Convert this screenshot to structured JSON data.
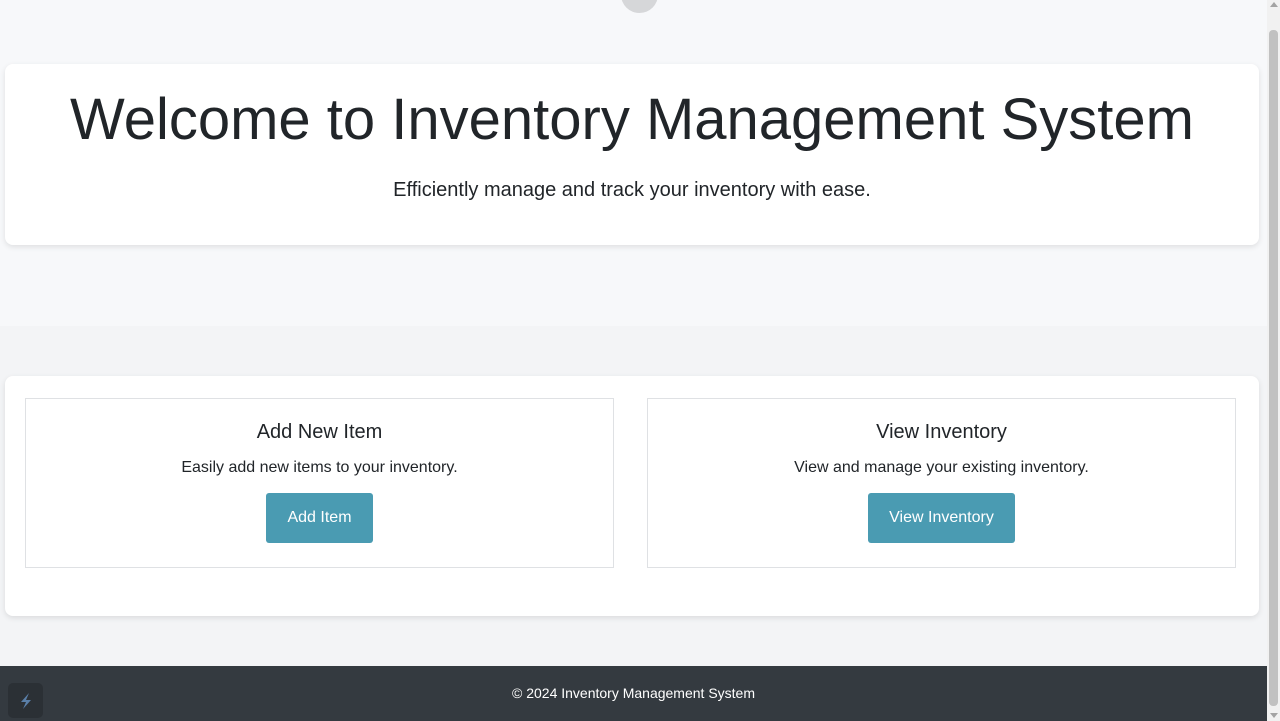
{
  "hero": {
    "title": "Welcome to Inventory Management System",
    "subtitle": "Efficiently manage and track your inventory with ease."
  },
  "features": [
    {
      "title": "Add New Item",
      "description": "Easily add new items to your inventory.",
      "button_label": "Add Item"
    },
    {
      "title": "View Inventory",
      "description": "View and manage your existing inventory.",
      "button_label": "View Inventory"
    }
  ],
  "footer": {
    "text": "© 2024 Inventory Management System"
  },
  "icons": {
    "corner_badge": "bolt-logo-icon"
  },
  "colors": {
    "button": "#4a9bb2",
    "footer": "#343a40"
  }
}
